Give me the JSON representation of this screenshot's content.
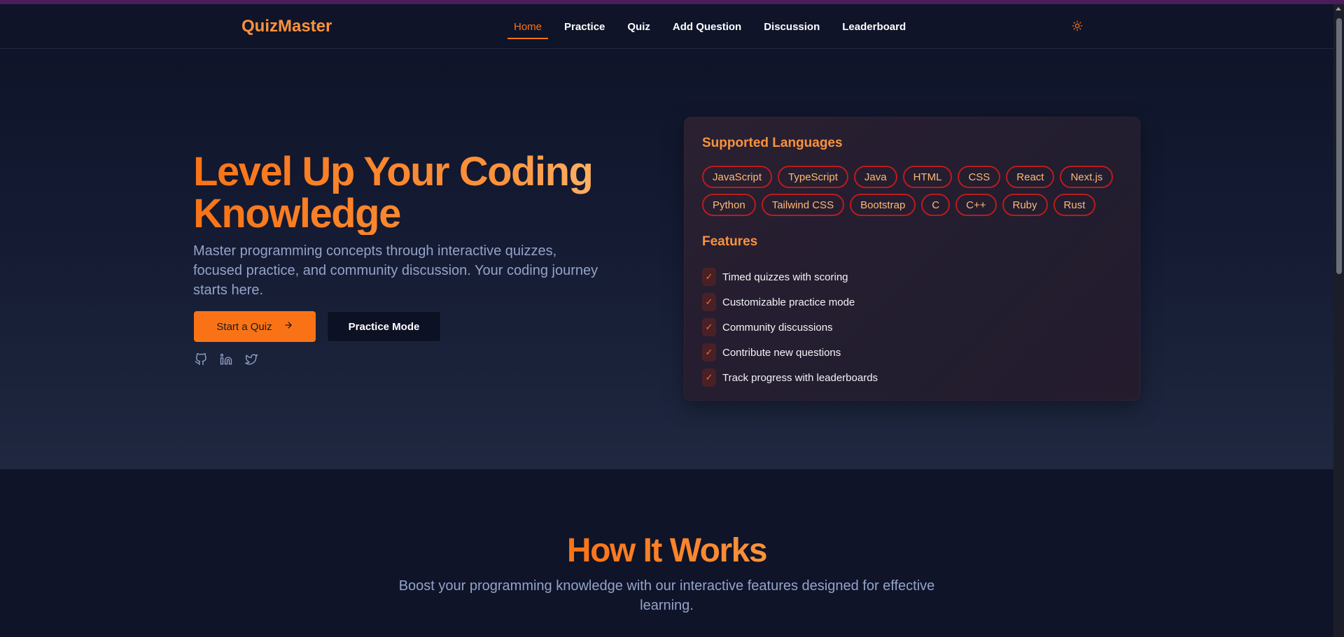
{
  "header": {
    "logo": "QuizMaster",
    "nav": [
      {
        "label": "Home",
        "active": true
      },
      {
        "label": "Practice"
      },
      {
        "label": "Quiz"
      },
      {
        "label": "Add Question"
      },
      {
        "label": "Discussion"
      },
      {
        "label": "Leaderboard"
      }
    ],
    "theme_icon": "sun-icon"
  },
  "hero": {
    "title": "Level Up Your Coding Knowledge",
    "subtitle": "Master programming concepts through interactive quizzes, focused practice, and community discussion. Your coding journey starts here.",
    "primary_button": "Start a Quiz",
    "secondary_button": "Practice Mode",
    "socials": [
      "github-icon",
      "linkedin-icon",
      "twitter-icon"
    ]
  },
  "card": {
    "languages_heading": "Supported Languages",
    "languages": [
      "JavaScript",
      "TypeScript",
      "Java",
      "HTML",
      "CSS",
      "React",
      "Next.js",
      "Python",
      "Tailwind CSS",
      "Bootstrap",
      "C",
      "C++",
      "Ruby",
      "Rust"
    ],
    "features_heading": "Features",
    "features": [
      "Timed quizzes with scoring",
      "Customizable practice mode",
      "Community discussions",
      "Contribute new questions",
      "Track progress with leaderboards"
    ],
    "check_glyph": "✓"
  },
  "how": {
    "title": "How It Works",
    "subtitle": "Boost your programming knowledge with our interactive features designed for effective learning."
  },
  "colors": {
    "accent": "#f97316",
    "background": "#0f1429"
  }
}
